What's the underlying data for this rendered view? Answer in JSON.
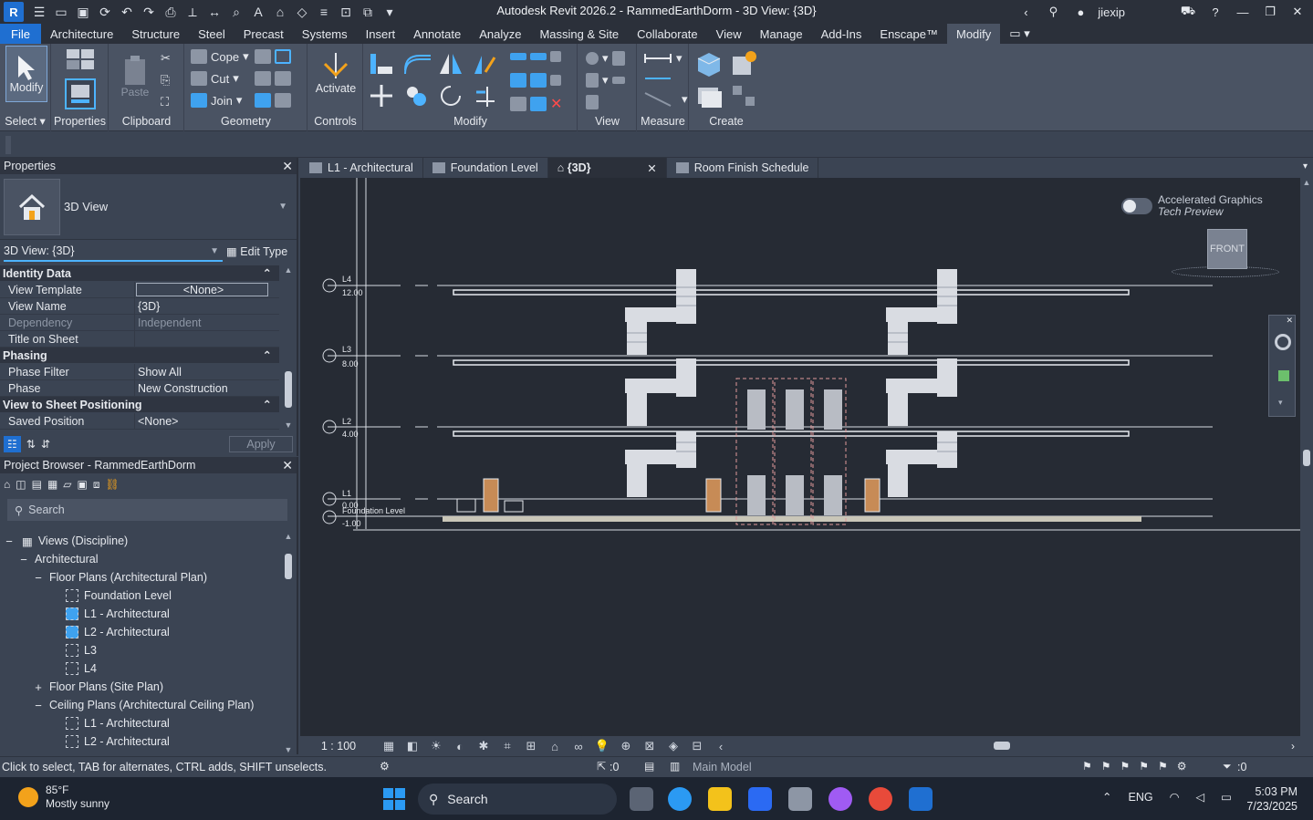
{
  "window": {
    "title": "Autodesk Revit 2026.2 - RammedEarthDorm - 3D View: {3D}",
    "user": "jiexip"
  },
  "ribbon_tabs": [
    "File",
    "Architecture",
    "Structure",
    "Steel",
    "Precast",
    "Systems",
    "Insert",
    "Annotate",
    "Analyze",
    "Massing & Site",
    "Collaborate",
    "View",
    "Manage",
    "Add-Ins",
    "Enscape™",
    "Modify"
  ],
  "ribbon": {
    "modify_label": "Modify",
    "select_label": "Select",
    "properties_label": "Properties",
    "paste_label": "Paste",
    "clipboard_label": "Clipboard",
    "cope_label": "Cope",
    "cut_label": "Cut",
    "join_label": "Join",
    "geometry_label": "Geometry",
    "activate_label": "Activate",
    "controls_label": "Controls",
    "modify_panel_label": "Modify",
    "view_label": "View",
    "measure_label": "Measure",
    "create_label": "Create"
  },
  "properties": {
    "title": "Properties",
    "type_name": "3D View",
    "instance_filter": "3D View: {3D}",
    "edit_type": "Edit Type",
    "apply": "Apply",
    "groups": [
      {
        "name": "Identity Data",
        "rows": [
          {
            "key": "View Template",
            "value": "<None>"
          },
          {
            "key": "View Name",
            "value": "{3D}"
          },
          {
            "key": "Dependency",
            "value": "Independent"
          },
          {
            "key": "Title on Sheet",
            "value": ""
          }
        ]
      },
      {
        "name": "Phasing",
        "rows": [
          {
            "key": "Phase Filter",
            "value": "Show All"
          },
          {
            "key": "Phase",
            "value": "New Construction"
          }
        ]
      },
      {
        "name": "View to Sheet Positioning",
        "rows": [
          {
            "key": "Saved Position",
            "value": "<None>"
          }
        ]
      }
    ]
  },
  "browser": {
    "title": "Project Browser - RammedEarthDorm",
    "search_placeholder": "Search",
    "nodes": [
      {
        "label": "Views (Discipline)",
        "toggle": "−"
      },
      {
        "label": "Architectural",
        "toggle": "−"
      },
      {
        "label": "Floor Plans (Architectural Plan)",
        "toggle": "−"
      },
      {
        "label": "Foundation Level",
        "toggle": ""
      },
      {
        "label": "L1 - Architectural",
        "toggle": ""
      },
      {
        "label": "L2 - Architectural",
        "toggle": ""
      },
      {
        "label": "L3",
        "toggle": ""
      },
      {
        "label": "L4",
        "toggle": ""
      },
      {
        "label": "Floor Plans (Site Plan)",
        "toggle": "+"
      },
      {
        "label": "Ceiling Plans (Architectural Ceiling Plan)",
        "toggle": "−"
      },
      {
        "label": "L1 - Architectural",
        "toggle": ""
      },
      {
        "label": "L2 - Architectural",
        "toggle": ""
      }
    ]
  },
  "view_tabs": [
    "L1 - Architectural",
    "Foundation Level",
    "{3D}",
    "Room Finish Schedule"
  ],
  "canvas": {
    "accel_line1": "Accelerated Graphics",
    "accel_line2": "Tech Preview",
    "viewcube_face": "FRONT",
    "levels": [
      {
        "name": "L4",
        "elev": "12.00"
      },
      {
        "name": "L3",
        "elev": "8.00"
      },
      {
        "name": "L2",
        "elev": "4.00"
      },
      {
        "name": "L1",
        "elev": "0.00"
      },
      {
        "name": "Foundation Level",
        "elev": "-1.00"
      }
    ]
  },
  "view_control": {
    "scale": "1 : 100"
  },
  "status": {
    "hint": "Click to select, TAB for alternates, CTRL adds, SHIFT unselects.",
    "zero1": ":0",
    "model": "Main Model",
    "zero2": ":0"
  },
  "taskbar": {
    "temp": "85°F",
    "weather": "Mostly sunny",
    "search": "Search",
    "lang": "ENG",
    "time": "5:03 PM",
    "date": "7/23/2025"
  },
  "colors": {
    "accent": "#1f6fd1",
    "highlight": "#4db3ff",
    "canvas_bg": "#262b34"
  }
}
